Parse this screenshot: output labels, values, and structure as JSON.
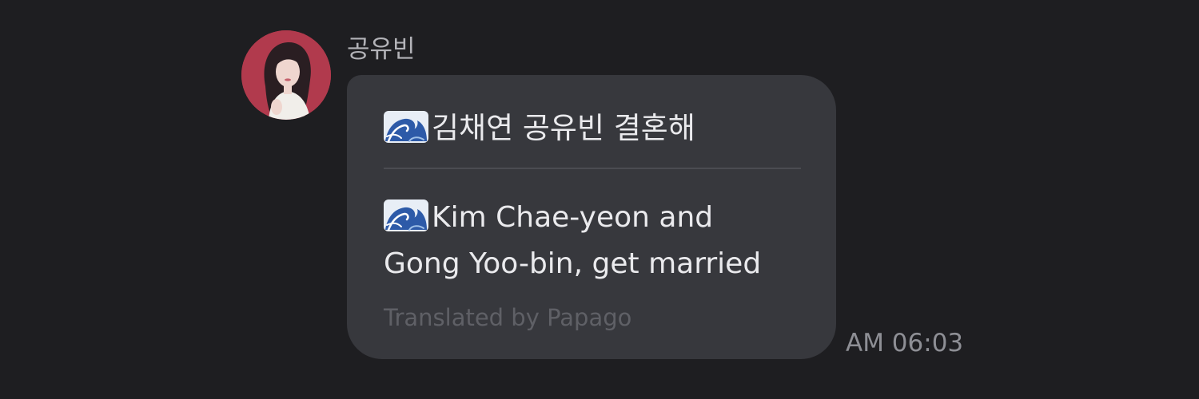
{
  "message": {
    "sender": "공유빈",
    "original": {
      "emoji_icon": "water-wave-icon",
      "text": "김채연 공유빈 결혼해"
    },
    "translation": {
      "emoji_icon": "water-wave-icon",
      "line1": "Kim Chae-yeon and",
      "line2": "Gong Yoo-bin, get married"
    },
    "credit": "Translated by Papago",
    "timestamp": "AM 06:03"
  },
  "colors": {
    "background": "#1e1e21",
    "bubble": "#37383d",
    "text_primary": "#eaeaed",
    "text_secondary": "#b3b3b8",
    "credit_text": "#5f6066",
    "timestamp_text": "#8e8f95",
    "avatar_background": "#b13a4d"
  }
}
